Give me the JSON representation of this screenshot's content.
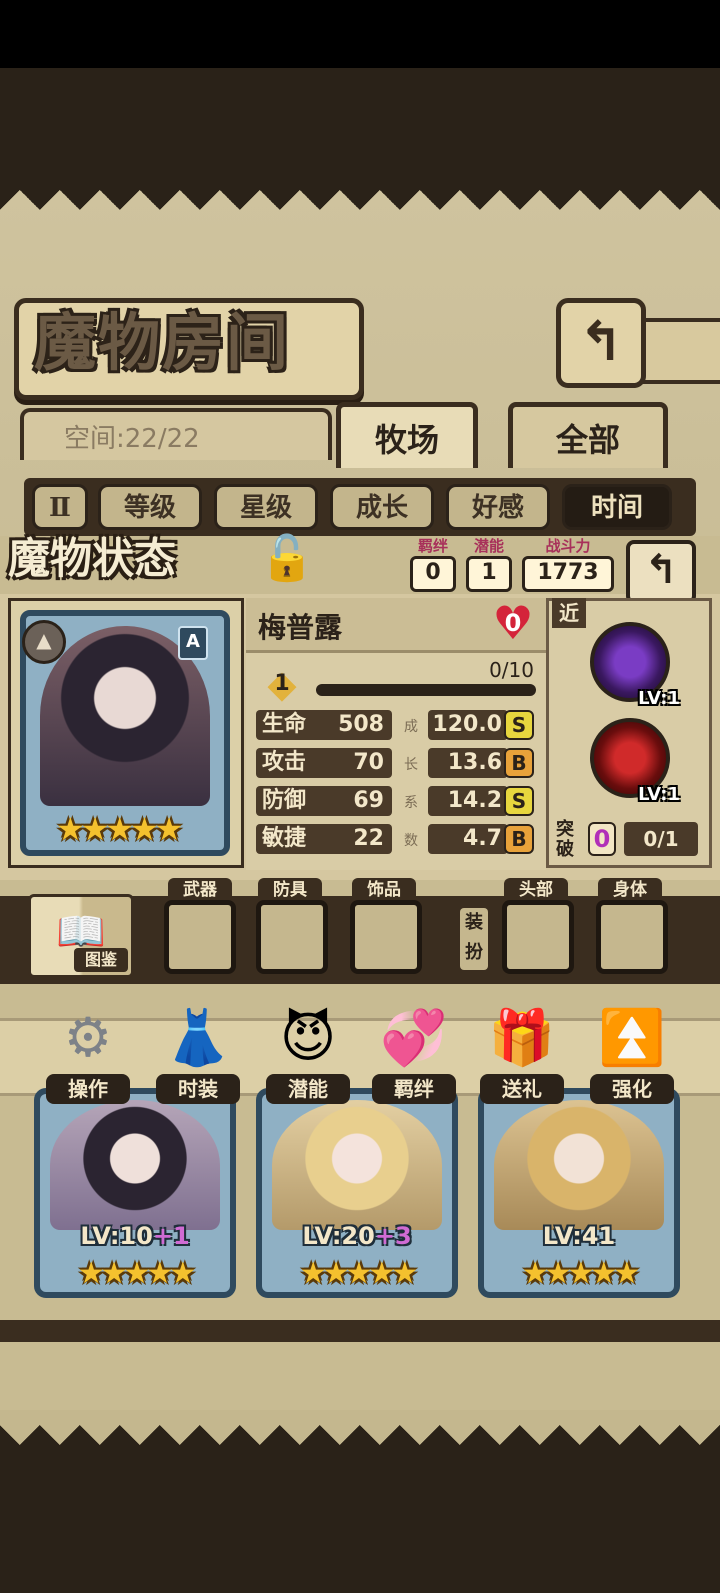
{
  "header": {
    "title": "魔物房间",
    "back_icon": "return-arrow-icon"
  },
  "room": {
    "space_label": "空间:22/22"
  },
  "tabs": [
    {
      "label": "牧场",
      "active": true
    },
    {
      "label": "全部",
      "active": false
    }
  ],
  "filters": {
    "sort_toggle": "Ⅱ",
    "items": [
      {
        "label": "等级",
        "active": false
      },
      {
        "label": "星级",
        "active": false
      },
      {
        "label": "成长",
        "active": false
      },
      {
        "label": "好感",
        "active": false
      },
      {
        "label": "时间",
        "active": true
      }
    ]
  },
  "status": {
    "section_title": "魔物状态",
    "bond": {
      "label": "羁绊",
      "value": "0"
    },
    "potential": {
      "label": "潜能",
      "value": "1"
    },
    "power": {
      "label": "战斗力",
      "value": "1773"
    }
  },
  "monster": {
    "name": "梅普露",
    "affection": "0",
    "grade": "A",
    "stars": 5,
    "level": "1",
    "exp_text": "0/10",
    "exp_fraction": 0,
    "stats": [
      {
        "label": "生命",
        "value": "508",
        "growth": "120.0",
        "grade": "S"
      },
      {
        "label": "攻击",
        "value": "70",
        "growth": "13.6",
        "grade": "B"
      },
      {
        "label": "防御",
        "value": "69",
        "growth": "14.2",
        "grade": "S"
      },
      {
        "label": "敏捷",
        "value": "22",
        "growth": "4.7",
        "grade": "B"
      }
    ],
    "growth_vertical": [
      "成",
      "长",
      "系",
      "数"
    ]
  },
  "skills": {
    "range_tag": "近",
    "items": [
      {
        "lv": "LV:1"
      },
      {
        "lv": "LV:1"
      }
    ],
    "break_label_1": "突",
    "break_label_2": "破",
    "break_count": "0",
    "break_progress": "0/1"
  },
  "equipment": {
    "book_label": "图鉴",
    "slots": [
      "武器",
      "防具",
      "饰品"
    ],
    "dress_label": "装扮",
    "dress_slots": [
      "头部",
      "身体"
    ]
  },
  "actions": [
    {
      "label": "操作",
      "icon": "gear-icon",
      "glyph": "⚙"
    },
    {
      "label": "时装",
      "icon": "dress-icon",
      "glyph": "👗"
    },
    {
      "label": "潜能",
      "icon": "demon-icon",
      "glyph": "😈"
    },
    {
      "label": "羁绊",
      "icon": "hearts-icon",
      "glyph": "💞"
    },
    {
      "label": "送礼",
      "icon": "gift-icon",
      "glyph": "🎁"
    },
    {
      "label": "强化",
      "icon": "up-arrows-icon",
      "glyph": "⏫"
    }
  ],
  "cards": [
    {
      "lv": "LV:10",
      "plus": "+1",
      "stars": 5
    },
    {
      "lv": "LV:20",
      "plus": "+3",
      "stars": 5
    },
    {
      "lv": "LV:41",
      "plus": "",
      "stars": 5
    }
  ]
}
